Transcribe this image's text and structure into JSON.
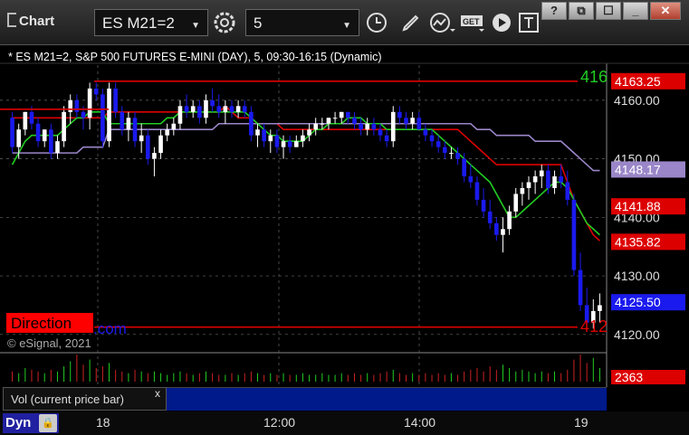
{
  "window": {
    "title": "Chart"
  },
  "toolbar": {
    "symbol": "ES M21=2",
    "interval": "5"
  },
  "window_buttons": {
    "help": "?",
    "restore": "⧉",
    "maximize": "☐",
    "close": "✕"
  },
  "chart_header": "* ES M21=2, S&P 500 FUTURES E-MINI (DAY), 5, 09:30-16:15 (Dynamic)",
  "overlay": {
    "direction": "Direction",
    "direction_suffix": ".com",
    "copyright": "© eSignal, 2021",
    "line_label_top": "416",
    "line_label_bottom": "412"
  },
  "y_ticks": [
    "4160.00",
    "4150.00",
    "4140.00",
    "4130.00",
    "4120.00"
  ],
  "price_tags": [
    {
      "label": "4163.25",
      "color": "#dd0000",
      "value": 4163.25
    },
    {
      "label": "4148.17",
      "color": "#9a86c8",
      "value": 4148.17
    },
    {
      "label": "4141.88",
      "color": "#dd0000",
      "value": 4141.88
    },
    {
      "label": "4135.82",
      "color": "#dd0000",
      "value": 4135.82
    },
    {
      "label": "4125.50",
      "color": "#1a1aee",
      "value": 4125.5
    }
  ],
  "volume_tag": {
    "label": "2363",
    "color": "#dd0000"
  },
  "volume_study": "Vol (current price bar)",
  "volume_close": "x",
  "time_labels": [
    "18",
    "12:00",
    "14:00",
    "19"
  ],
  "bottom_bar": {
    "mode": "Dyn"
  },
  "chart_data": {
    "type": "candlestick",
    "ylim": [
      4117.5,
      4166.0
    ],
    "hlines": [
      {
        "value": 4163.25,
        "color": "#dd0000"
      },
      {
        "value": 4121.25,
        "color": "#dd0000"
      }
    ],
    "candles": [
      [
        4157,
        4158,
        4151,
        4152
      ],
      [
        4152,
        4156,
        4150,
        4155
      ],
      [
        4155,
        4158,
        4154,
        4158
      ],
      [
        4158,
        4159,
        4155,
        4156
      ],
      [
        4156,
        4157,
        4152,
        4153
      ],
      [
        4153,
        4155,
        4152,
        4155
      ],
      [
        4155,
        4156,
        4150,
        4151
      ],
      [
        4151,
        4154,
        4150,
        4153
      ],
      [
        4153,
        4159,
        4152,
        4158
      ],
      [
        4158,
        4161,
        4156,
        4160
      ],
      [
        4160,
        4161,
        4157,
        4158
      ],
      [
        4158,
        4159,
        4155,
        4157
      ],
      [
        4157,
        4163,
        4155,
        4162
      ],
      [
        4162,
        4163,
        4160,
        4161
      ],
      [
        4161,
        4162,
        4152,
        4153
      ],
      [
        4153,
        4163,
        4152,
        4162
      ],
      [
        4162,
        4163,
        4157,
        4158
      ],
      [
        4158,
        4159,
        4154,
        4155
      ],
      [
        4155,
        4158,
        4153,
        4157
      ],
      [
        4157,
        4158,
        4152,
        4153
      ],
      [
        4153,
        4156,
        4151,
        4154
      ],
      [
        4154,
        4155,
        4149,
        4150
      ],
      [
        4150,
        4152,
        4147,
        4151
      ],
      [
        4151,
        4155,
        4150,
        4154
      ],
      [
        4154,
        4156,
        4153,
        4155
      ],
      [
        4155,
        4157,
        4154,
        4156
      ],
      [
        4156,
        4160,
        4155,
        4159
      ],
      [
        4159,
        4161,
        4157,
        4158
      ],
      [
        4158,
        4160,
        4157,
        4159
      ],
      [
        4159,
        4160,
        4156,
        4157
      ],
      [
        4157,
        4161,
        4156,
        4160
      ],
      [
        4160,
        4162,
        4158,
        4159
      ],
      [
        4159,
        4161,
        4157,
        4158
      ],
      [
        4158,
        4160,
        4156,
        4159
      ],
      [
        4159,
        4160,
        4157,
        4158
      ],
      [
        4158,
        4160,
        4157,
        4159
      ],
      [
        4159,
        4160,
        4157,
        4158
      ],
      [
        4158,
        4159,
        4153,
        4154
      ],
      [
        4154,
        4156,
        4152,
        4155
      ],
      [
        4155,
        4156,
        4152,
        4153
      ],
      [
        4153,
        4155,
        4151,
        4154
      ],
      [
        4154,
        4155,
        4151,
        4152
      ],
      [
        4152,
        4154,
        4150,
        4153
      ],
      [
        4153,
        4154,
        4151,
        4152
      ],
      [
        4152,
        4154,
        4152,
        4153
      ],
      [
        4153,
        4155,
        4152,
        4154
      ],
      [
        4154,
        4156,
        4153,
        4155
      ],
      [
        4155,
        4157,
        4154,
        4156
      ],
      [
        4156,
        4157,
        4155,
        4156
      ],
      [
        4156,
        4157,
        4155,
        4157
      ],
      [
        4157,
        4158,
        4156,
        4157
      ],
      [
        4157,
        4158,
        4156,
        4158
      ],
      [
        4158,
        4158,
        4156,
        4157
      ],
      [
        4157,
        4158,
        4155,
        4156
      ],
      [
        4156,
        4157,
        4154,
        4155
      ],
      [
        4155,
        4157,
        4154,
        4156
      ],
      [
        4156,
        4157,
        4154,
        4155
      ],
      [
        4155,
        4156,
        4153,
        4154
      ],
      [
        4154,
        4155,
        4152,
        4153
      ],
      [
        4153,
        4159,
        4152,
        4158
      ],
      [
        4158,
        4159,
        4156,
        4157
      ],
      [
        4157,
        4158,
        4155,
        4156
      ],
      [
        4156,
        4158,
        4155,
        4157
      ],
      [
        4157,
        4158,
        4155,
        4155
      ],
      [
        4155,
        4156,
        4153,
        4154
      ],
      [
        4154,
        4155,
        4152,
        4153
      ],
      [
        4153,
        4154,
        4151,
        4152
      ],
      [
        4152,
        4153,
        4150,
        4151
      ],
      [
        4151,
        4152,
        4150,
        4151
      ],
      [
        4151,
        4152,
        4149,
        4150
      ],
      [
        4150,
        4151,
        4146,
        4147
      ],
      [
        4147,
        4149,
        4145,
        4146
      ],
      [
        4146,
        4147,
        4142,
        4143
      ],
      [
        4143,
        4145,
        4140,
        4141
      ],
      [
        4141,
        4143,
        4138,
        4139
      ],
      [
        4139,
        4140,
        4136,
        4137
      ],
      [
        4137,
        4140,
        4134,
        4138
      ],
      [
        4138,
        4142,
        4137,
        4141
      ],
      [
        4141,
        4145,
        4140,
        4144
      ],
      [
        4144,
        4146,
        4142,
        4145
      ],
      [
        4145,
        4147,
        4143,
        4146
      ],
      [
        4146,
        4148,
        4144,
        4147
      ],
      [
        4147,
        4149,
        4145,
        4148
      ],
      [
        4148,
        4149,
        4144,
        4145
      ],
      [
        4145,
        4148,
        4144,
        4147
      ],
      [
        4147,
        4149,
        4145,
        4146
      ],
      [
        4146,
        4148,
        4142,
        4143
      ],
      [
        4143,
        4144,
        4130,
        4131
      ],
      [
        4131,
        4134,
        4124,
        4125
      ],
      [
        4125,
        4128,
        4121,
        4122
      ],
      [
        4122,
        4126,
        4121,
        4124
      ],
      [
        4124,
        4127,
        4122,
        4125
      ]
    ],
    "series": [
      {
        "color": "#dd0000",
        "values": [
          4157,
          4157,
          4157,
          4157,
          4157,
          4157,
          4157,
          4157,
          4157,
          4157,
          4157,
          4157,
          4157,
          4157,
          4157,
          4158,
          4158,
          4158,
          4158,
          4158,
          4158,
          4158,
          4158,
          4158,
          4158,
          4158,
          4158,
          4158,
          4158,
          4158,
          4158,
          4158,
          4158,
          4159,
          4158,
          4157,
          4157,
          4157,
          4156,
          4156,
          4156,
          4156,
          4155,
          4155,
          4155,
          4155,
          4155,
          4155,
          4155,
          4155,
          4155,
          4155,
          4155,
          4155,
          4155,
          4155,
          4155,
          4155,
          4155,
          4155,
          4155,
          4155,
          4155,
          4155,
          4155,
          4155,
          4155,
          4155,
          4155,
          4155,
          4154,
          4153,
          4152,
          4151,
          4150,
          4149,
          4149,
          4149,
          4149,
          4149,
          4149,
          4149,
          4149,
          4149,
          4149,
          4149,
          4146,
          4143,
          4141,
          4139,
          4137,
          4136
        ]
      },
      {
        "color": "#9a86c8",
        "values": [
          4151,
          4151,
          4151,
          4151,
          4151,
          4151,
          4151,
          4151,
          4151,
          4151,
          4151,
          4152,
          4152,
          4152,
          4152,
          4155,
          4155,
          4155,
          4155,
          4155,
          4155,
          4155,
          4155,
          4155,
          4155,
          4155,
          4155,
          4155,
          4155,
          4155,
          4155,
          4155,
          4156,
          4156,
          4156,
          4156,
          4156,
          4156,
          4156,
          4156,
          4156,
          4156,
          4156,
          4156,
          4156,
          4156,
          4156,
          4156,
          4156,
          4156,
          4156,
          4156,
          4156,
          4156,
          4156,
          4156,
          4156,
          4156,
          4156,
          4156,
          4156,
          4156,
          4156,
          4156,
          4156,
          4156,
          4156,
          4156,
          4156,
          4156,
          4156,
          4156,
          4155,
          4155,
          4155,
          4154,
          4154,
          4154,
          4154,
          4154,
          4154,
          4153,
          4153,
          4153,
          4153,
          4153,
          4152,
          4151,
          4150,
          4149,
          4148,
          4148
        ]
      },
      {
        "color": "#22cc22",
        "values": [
          4149,
          4151,
          4153,
          4154,
          4154,
          4154,
          4154,
          4154,
          4155,
          4156,
          4157,
          4157,
          4158,
          4158,
          4158,
          4156,
          4156,
          4156,
          4156,
          4156,
          4156,
          4156,
          4156,
          4156,
          4157,
          4157,
          4158,
          4158,
          4158,
          4158,
          4158,
          4158,
          4158,
          4158,
          4158,
          4158,
          4158,
          4157,
          4156,
          4155,
          4154,
          4154,
          4153,
          4153,
          4153,
          4153,
          4154,
          4155,
          4155,
          4156,
          4156,
          4156,
          4157,
          4157,
          4157,
          4156,
          4156,
          4156,
          4155,
          4155,
          4155,
          4155,
          4155,
          4155,
          4155,
          4155,
          4154,
          4153,
          4152,
          4151,
          4150,
          4149,
          4148,
          4147,
          4146,
          4144,
          4142,
          4140,
          4140,
          4141,
          4142,
          4143,
          4144,
          4145,
          4146,
          4146,
          4145,
          4143,
          4141,
          4139,
          4138,
          4137
        ]
      }
    ],
    "volume": [
      6,
      5,
      8,
      7,
      6,
      5,
      7,
      6,
      9,
      12,
      16,
      10,
      13,
      8,
      9,
      11,
      7,
      6,
      5,
      7,
      6,
      5,
      6,
      5,
      4,
      5,
      6,
      5,
      4,
      5,
      6,
      5,
      4,
      4,
      5,
      4,
      5,
      6,
      5,
      4,
      5,
      4,
      5,
      4,
      4,
      5,
      4,
      4,
      5,
      4,
      4,
      5,
      4,
      5,
      4,
      5,
      4,
      5,
      6,
      7,
      5,
      4,
      5,
      4,
      5,
      4,
      5,
      4,
      5,
      4,
      6,
      7,
      8,
      6,
      9,
      7,
      10,
      8,
      6,
      7,
      6,
      5,
      6,
      5,
      6,
      5,
      7,
      13,
      16,
      11,
      14,
      8
    ]
  }
}
